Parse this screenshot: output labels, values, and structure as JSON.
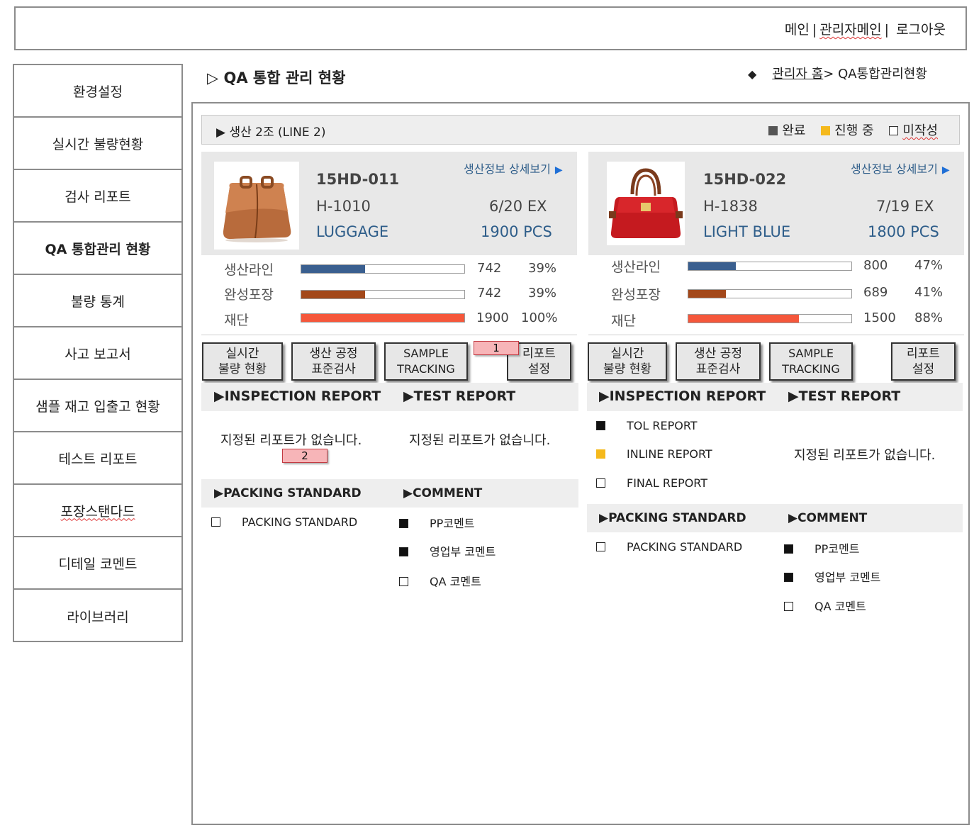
{
  "header": {
    "nav": [
      "메인",
      "관리자메인",
      "로그아웃"
    ]
  },
  "sidebar": {
    "items": [
      {
        "label": "환경설정"
      },
      {
        "label": "실시간 불량현황"
      },
      {
        "label": "검사 리포트"
      },
      {
        "label": "QA 통합관리 현황"
      },
      {
        "label": "불량 통계"
      },
      {
        "label": "사고 보고서"
      },
      {
        "label": "샘플 재고 입출고 현황"
      },
      {
        "label": "테스트 리포트"
      },
      {
        "label": "포장스탠다드"
      },
      {
        "label": "디테일 코멘트"
      },
      {
        "label": "라이브러리"
      }
    ],
    "active_index": 3
  },
  "page": {
    "title": "▷ QA 통합 관리 현황",
    "breadcrumb_home": "관리자 홈",
    "breadcrumb_current": "> QA통합관리현황"
  },
  "line": {
    "title": "▶ 생산 2조 (LINE 2)",
    "legend": [
      {
        "label": "완료",
        "color": "#555555",
        "style": "filled"
      },
      {
        "label": "진행 중",
        "color": "#f5b91c",
        "style": "filled"
      },
      {
        "label": "미작성",
        "color": "#ffffff",
        "style": "outline"
      }
    ]
  },
  "products": [
    {
      "detail_link": "생산정보 상세보기",
      "code": "15HD-011",
      "model": "H-1010",
      "ex_date": "6/20 EX",
      "color": "LUGGAGE",
      "qty": "1900 PCS",
      "image": "brown-handbag",
      "progress": [
        {
          "label": "생산라인",
          "value": "742",
          "percent": "39%",
          "fraction": 0.39,
          "color": "#3a5f8f"
        },
        {
          "label": "완성포장",
          "value": "742",
          "percent": "39%",
          "fraction": 0.39,
          "color": "#a3481a"
        },
        {
          "label": "재단",
          "value": "1900",
          "percent": "100%",
          "fraction": 1.0,
          "color": "#f5573b"
        }
      ],
      "buttons": [
        "실시간\n불량 현황",
        "생산 공정\n표준검사",
        "SAMPLE\nTRACKING",
        "리포트\n설정"
      ],
      "marker1": "1",
      "marker2": "2",
      "inspection_title": "▶INSPECTION REPORT",
      "test_title": "▶TEST REPORT",
      "inspection_empty": "지정된 리포트가 없습니다.",
      "test_empty": "지정된 리포트가 없습니다.",
      "packing_title": "▶PACKING STANDARD",
      "comment_title": "▶COMMENT",
      "packing_items": [
        {
          "label": "PACKING STANDARD",
          "status": "none"
        }
      ],
      "comment_items": [
        {
          "label": "PP코멘트",
          "status": "done"
        },
        {
          "label": "영업부 코멘트",
          "status": "done"
        },
        {
          "label": "QA 코멘트",
          "status": "none"
        }
      ]
    },
    {
      "detail_link": "생산정보 상세보기",
      "code": "15HD-022",
      "model": "H-1838",
      "ex_date": "7/19 EX",
      "color": "LIGHT BLUE",
      "qty": "1800 PCS",
      "image": "red-handbag",
      "progress": [
        {
          "label": "생산라인",
          "value": "800",
          "percent": "47%",
          "fraction": 0.29,
          "color": "#3a5f8f"
        },
        {
          "label": "완성포장",
          "value": "689",
          "percent": "41%",
          "fraction": 0.23,
          "color": "#a3481a"
        },
        {
          "label": "재단",
          "value": "1500",
          "percent": "88%",
          "fraction": 0.68,
          "color": "#f5573b"
        }
      ],
      "buttons": [
        "실시간\n불량 현황",
        "생산 공정\n표준검사",
        "SAMPLE\nTRACKING",
        "리포트\n설정"
      ],
      "inspection_title": "▶INSPECTION REPORT",
      "test_title": "▶TEST REPORT",
      "inspection_items": [
        {
          "label": "TOL REPORT",
          "status": "done"
        },
        {
          "label": "INLINE REPORT",
          "status": "progress"
        },
        {
          "label": "FINAL REPORT",
          "status": "none"
        }
      ],
      "test_empty": "지정된 리포트가 없습니다.",
      "packing_title": "▶PACKING STANDARD",
      "comment_title": "▶COMMENT",
      "packing_items": [
        {
          "label": "PACKING STANDARD",
          "status": "none"
        }
      ],
      "comment_items": [
        {
          "label": "PP코멘트",
          "status": "done"
        },
        {
          "label": "영업부 코멘트",
          "status": "done"
        },
        {
          "label": "QA 코멘트",
          "status": "none"
        }
      ]
    }
  ]
}
